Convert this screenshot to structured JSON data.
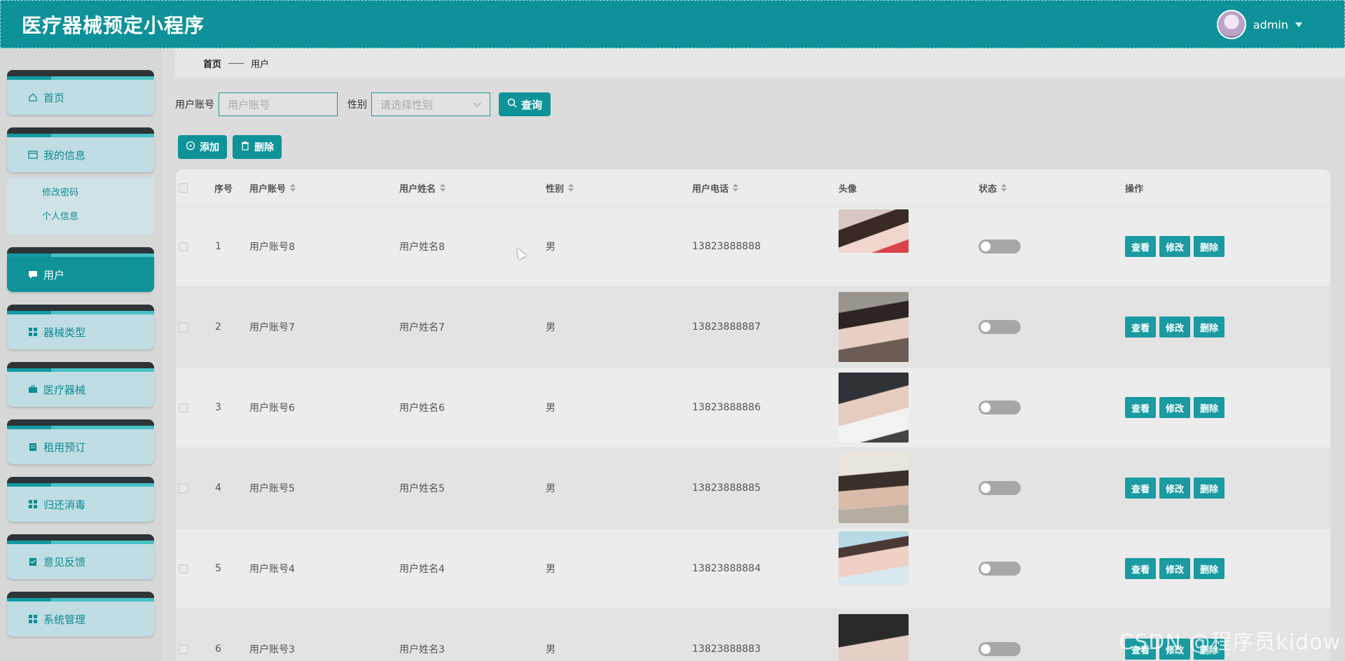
{
  "header": {
    "title": "医疗器械预定小程序",
    "username": "admin"
  },
  "sidebar": {
    "items": [
      {
        "label": "首页",
        "icon": "home-icon"
      },
      {
        "label": "我的信息",
        "icon": "card-icon",
        "sub": [
          "修改密码",
          "个人信息"
        ]
      },
      {
        "label": "用户",
        "icon": "chat-icon",
        "active": true
      },
      {
        "label": "器械类型",
        "icon": "grid-icon"
      },
      {
        "label": "医疗器械",
        "icon": "briefcase-icon"
      },
      {
        "label": "租用预订",
        "icon": "clipboard-icon"
      },
      {
        "label": "归还消毒",
        "icon": "grid-icon"
      },
      {
        "label": "意见反馈",
        "icon": "clipboard-check-icon"
      },
      {
        "label": "系统管理",
        "icon": "grid-icon"
      }
    ]
  },
  "breadcrumb": {
    "home": "首页",
    "current": "用户"
  },
  "search": {
    "account_label": "用户账号",
    "account_placeholder": "用户账号",
    "gender_label": "性别",
    "gender_placeholder": "请选择性别",
    "query_button": "查询"
  },
  "actions": {
    "add": "添加",
    "delete": "删除"
  },
  "table": {
    "columns": [
      "序号",
      "用户账号",
      "用户姓名",
      "性别",
      "用户电话",
      "头像",
      "状态",
      "操作"
    ],
    "rows": [
      {
        "index": "1",
        "account": "用户账号8",
        "name": "用户姓名8",
        "gender": "男",
        "phone": "13823888888"
      },
      {
        "index": "2",
        "account": "用户账号7",
        "name": "用户姓名7",
        "gender": "男",
        "phone": "13823888887"
      },
      {
        "index": "3",
        "account": "用户账号6",
        "name": "用户姓名6",
        "gender": "男",
        "phone": "13823888886"
      },
      {
        "index": "4",
        "account": "用户账号5",
        "name": "用户姓名5",
        "gender": "男",
        "phone": "13823888885"
      },
      {
        "index": "5",
        "account": "用户账号4",
        "name": "用户姓名4",
        "gender": "男",
        "phone": "13823888884"
      },
      {
        "index": "6",
        "account": "用户账号3",
        "name": "用户姓名3",
        "gender": "男",
        "phone": "13823888883"
      }
    ],
    "row_actions": {
      "view": "查看",
      "edit": "修改",
      "delete": "删除"
    }
  },
  "watermark": "CSDN @程序员kidow"
}
